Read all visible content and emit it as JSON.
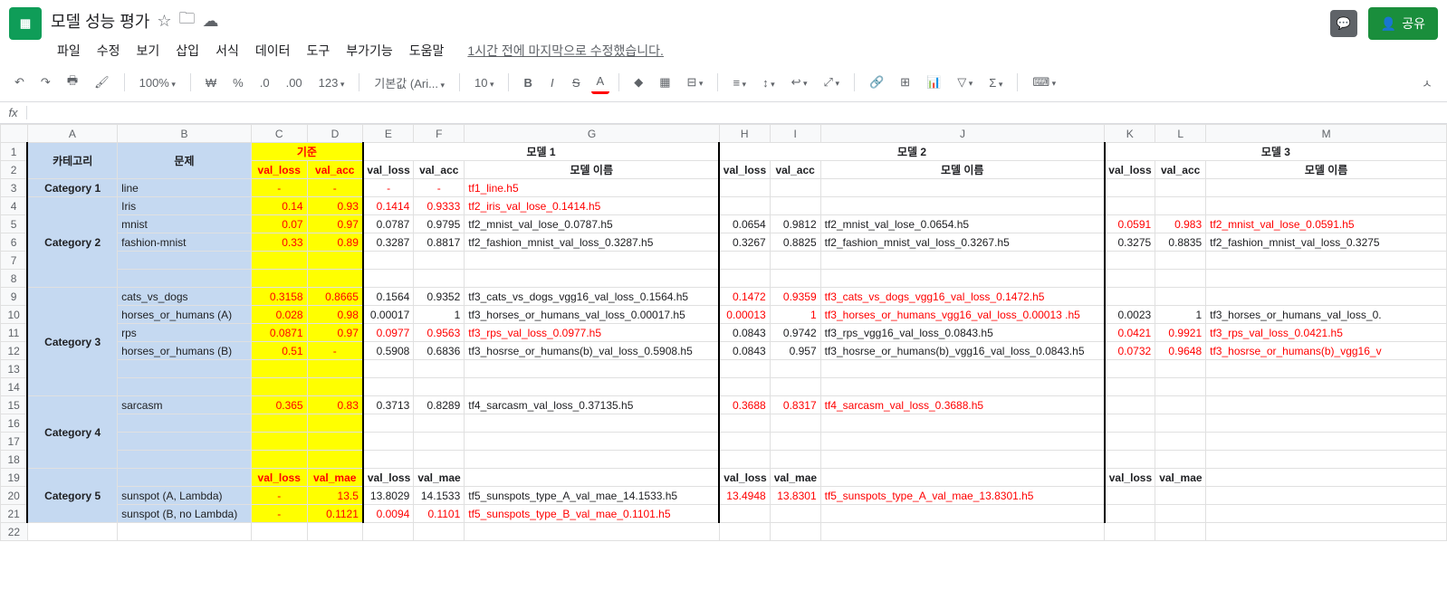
{
  "doc": {
    "title": "모델 성능 평가"
  },
  "menu": {
    "file": "파일",
    "edit": "수정",
    "view": "보기",
    "insert": "삽입",
    "format": "서식",
    "data": "데이터",
    "tools": "도구",
    "addons": "부가기능",
    "help": "도움말",
    "last_edit": "1시간 전에 마지막으로 수정했습니다."
  },
  "share": {
    "label": "공유"
  },
  "toolbar": {
    "zoom": "100%",
    "currency": "₩",
    "percent": "%",
    "dec_dec": ".0",
    "dec_inc": ".00",
    "num_fmt": "123",
    "font": "기본값 (Ari...",
    "size": "10"
  },
  "cols": [
    "",
    "A",
    "B",
    "C",
    "D",
    "E",
    "F",
    "G",
    "H",
    "I",
    "J",
    "K",
    "L",
    "M"
  ],
  "hdr": {
    "category": "카테고리",
    "problem": "문제",
    "baseline": "기준",
    "val_loss": "val_loss",
    "val_acc": "val_acc",
    "val_mae": "val_mae",
    "model1": "모델 1",
    "model2": "모델 2",
    "model3": "모델 3",
    "model_name": "모델 이름"
  },
  "rows": {
    "r3": {
      "cat": "Category 1",
      "prob": "line",
      "m1_name": "tf1_line.h5",
      "b_loss": "-",
      "b_acc": "-",
      "m1_loss": "-",
      "m1_acc": "-"
    },
    "r4": {
      "prob": "Iris",
      "b_loss": "0.14",
      "b_acc": "0.93",
      "m1_loss": "0.1414",
      "m1_acc": "0.9333",
      "m1_name": "tf2_iris_val_lose_0.1414.h5"
    },
    "r5": {
      "prob": "mnist",
      "b_loss": "0.07",
      "b_acc": "0.97",
      "m1_loss": "0.0787",
      "m1_acc": "0.9795",
      "m1_name": "tf2_mnist_val_lose_0.0787.h5",
      "m2_loss": "0.0654",
      "m2_acc": "0.9812",
      "m2_name": "tf2_mnist_val_lose_0.0654.h5",
      "m3_loss": "0.0591",
      "m3_acc": "0.983",
      "m3_name": "tf2_mnist_val_lose_0.0591.h5"
    },
    "r6": {
      "cat": "Category 2",
      "prob": "fashion-mnist",
      "b_loss": "0.33",
      "b_acc": "0.89",
      "m1_loss": "0.3287",
      "m1_acc": "0.8817",
      "m1_name": "tf2_fashion_mnist_val_loss_0.3287.h5",
      "m2_loss": "0.3267",
      "m2_acc": "0.8825",
      "m2_name": "tf2_fashion_mnist_val_loss_0.3267.h5",
      "m3_loss": "0.3275",
      "m3_acc": "0.8835",
      "m3_name": "tf2_fashion_mnist_val_loss_0.3275"
    },
    "r9": {
      "prob": "cats_vs_dogs",
      "b_loss": "0.3158",
      "b_acc": "0.8665",
      "m1_loss": "0.1564",
      "m1_acc": "0.9352",
      "m1_name": "tf3_cats_vs_dogs_vgg16_val_loss_0.1564.h5",
      "m2_loss": "0.1472",
      "m2_acc": "0.9359",
      "m2_name": "tf3_cats_vs_dogs_vgg16_val_loss_0.1472.h5"
    },
    "r10": {
      "prob": "horses_or_humans (A)",
      "b_loss": "0.028",
      "b_acc": "0.98",
      "m1_loss": "0.00017",
      "m1_acc": "1",
      "m1_name": "tf3_horses_or_humans_val_loss_0.00017.h5",
      "m2_loss": "0.00013",
      "m2_acc": "1",
      "m2_name": "tf3_horses_or_humans_vgg16_val_loss_0.00013 .h5",
      "m3_loss": "0.0023",
      "m3_acc": "1",
      "m3_name": "tf3_horses_or_humans_val_loss_0."
    },
    "r11": {
      "cat": "Category 3",
      "prob": "rps",
      "b_loss": "0.0871",
      "b_acc": "0.97",
      "m1_loss": "0.0977",
      "m1_acc": "0.9563",
      "m1_name": "tf3_rps_val_loss_0.0977.h5",
      "m2_loss": "0.0843",
      "m2_acc": "0.9742",
      "m2_name": "tf3_rps_vgg16_val_loss_0.0843.h5",
      "m3_loss": "0.0421",
      "m3_acc": "0.9921",
      "m3_name": "tf3_rps_val_loss_0.0421.h5"
    },
    "r12": {
      "prob": "horses_or_humans (B)",
      "b_loss": "0.51",
      "b_acc": "-",
      "m1_loss": "0.5908",
      "m1_acc": "0.6836",
      "m1_name": "tf3_hosrse_or_humans(b)_val_loss_0.5908.h5",
      "m2_loss": "0.0843",
      "m2_acc": "0.957",
      "m2_name": "tf3_hosrse_or_humans(b)_vgg16_val_loss_0.0843.h5",
      "m3_loss": "0.0732",
      "m3_acc": "0.9648",
      "m3_name": "tf3_hosrse_or_humans(b)_vgg16_v"
    },
    "r15": {
      "cat": "Category 4",
      "prob": "sarcasm",
      "b_loss": "0.365",
      "b_acc": "0.83",
      "m1_loss": "0.3713",
      "m1_acc": "0.8289",
      "m1_name": "tf4_sarcasm_val_loss_0.37135.h5",
      "m2_loss": "0.3688",
      "m2_acc": "0.8317",
      "m2_name": "tf4_sarcasm_val_loss_0.3688.h5"
    },
    "r20": {
      "cat": "Category 5",
      "prob": "sunspot (A, Lambda)",
      "b_loss": "-",
      "b_mae": "13.5",
      "m1_loss": "13.8029",
      "m1_mae": "14.1533",
      "m1_name": "tf5_sunspots_type_A_val_mae_14.1533.h5",
      "m2_loss": "13.4948",
      "m2_mae": "13.8301",
      "m2_name": "tf5_sunspots_type_A_val_mae_13.8301.h5"
    },
    "r21": {
      "prob": "sunspot (B, no Lambda)",
      "b_loss": "-",
      "b_mae": "0.1121",
      "m1_loss": "0.0094",
      "m1_mae": "0.1101",
      "m1_name": "tf5_sunspots_type_B_val_mae_0.1101.h5"
    }
  }
}
